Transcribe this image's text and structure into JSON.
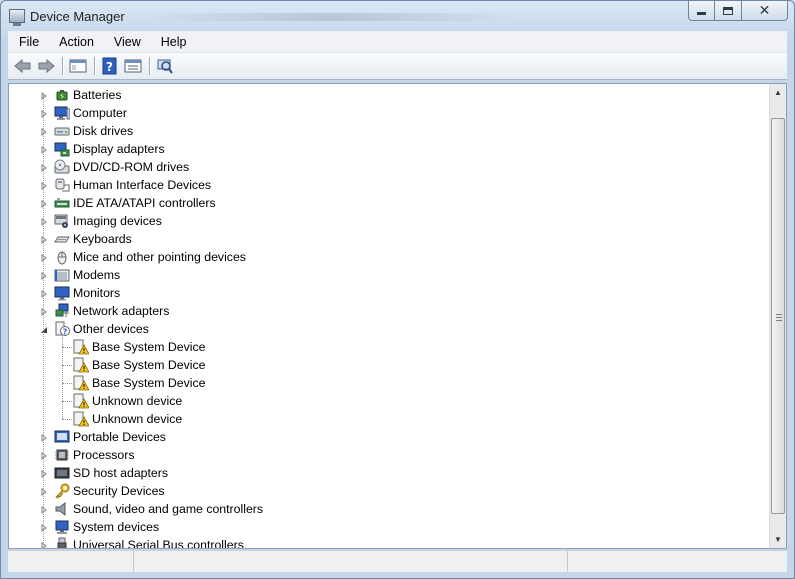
{
  "window": {
    "title": "Device Manager",
    "minimize_label": "",
    "maximize_label": "",
    "close_label": "✕"
  },
  "menu": [
    "File",
    "Action",
    "View",
    "Help"
  ],
  "toolbar": {
    "buttons": [
      "back-arrow-icon",
      "forward-arrow-icon",
      "show-hide-console-tree-icon",
      "help-icon",
      "properties-icon",
      "scan-hardware-icon"
    ]
  },
  "tree": {
    "categories": [
      {
        "label": "Batteries",
        "icon": "battery-icon",
        "expanded": false
      },
      {
        "label": "Computer",
        "icon": "computer-icon",
        "expanded": false
      },
      {
        "label": "Disk drives",
        "icon": "disk-drive-icon",
        "expanded": false
      },
      {
        "label": "Display adapters",
        "icon": "display-adapter-icon",
        "expanded": false
      },
      {
        "label": "DVD/CD-ROM drives",
        "icon": "dvd-drive-icon",
        "expanded": false
      },
      {
        "label": "Human Interface Devices",
        "icon": "hid-icon",
        "expanded": false
      },
      {
        "label": "IDE ATA/ATAPI controllers",
        "icon": "ide-controller-icon",
        "expanded": false
      },
      {
        "label": "Imaging devices",
        "icon": "camera-icon",
        "expanded": false
      },
      {
        "label": "Keyboards",
        "icon": "keyboard-icon",
        "expanded": false
      },
      {
        "label": "Mice and other pointing devices",
        "icon": "mouse-icon",
        "expanded": false
      },
      {
        "label": "Modems",
        "icon": "modem-icon",
        "expanded": false
      },
      {
        "label": "Monitors",
        "icon": "monitor-icon",
        "expanded": false
      },
      {
        "label": "Network adapters",
        "icon": "network-adapter-icon",
        "expanded": false
      },
      {
        "label": "Other devices",
        "icon": "other-devices-icon",
        "expanded": true,
        "children": [
          {
            "label": "Base System Device",
            "icon": "warning-device-icon"
          },
          {
            "label": "Base System Device",
            "icon": "warning-device-icon"
          },
          {
            "label": "Base System Device",
            "icon": "warning-device-icon"
          },
          {
            "label": "Unknown device",
            "icon": "warning-device-icon"
          },
          {
            "label": "Unknown device",
            "icon": "warning-device-icon"
          }
        ]
      },
      {
        "label": "Portable Devices",
        "icon": "portable-device-icon",
        "expanded": false
      },
      {
        "label": "Processors",
        "icon": "processor-icon",
        "expanded": false
      },
      {
        "label": "SD host adapters",
        "icon": "sd-host-icon",
        "expanded": false
      },
      {
        "label": "Security Devices",
        "icon": "security-key-icon",
        "expanded": false
      },
      {
        "label": "Sound, video and game controllers",
        "icon": "speaker-icon",
        "expanded": false
      },
      {
        "label": "System devices",
        "icon": "system-device-icon",
        "expanded": false
      },
      {
        "label": "Universal Serial Bus controllers",
        "icon": "usb-icon",
        "expanded": false
      }
    ]
  },
  "colors": {
    "accent": "#3b6fd1",
    "warning": "#f3c623"
  }
}
